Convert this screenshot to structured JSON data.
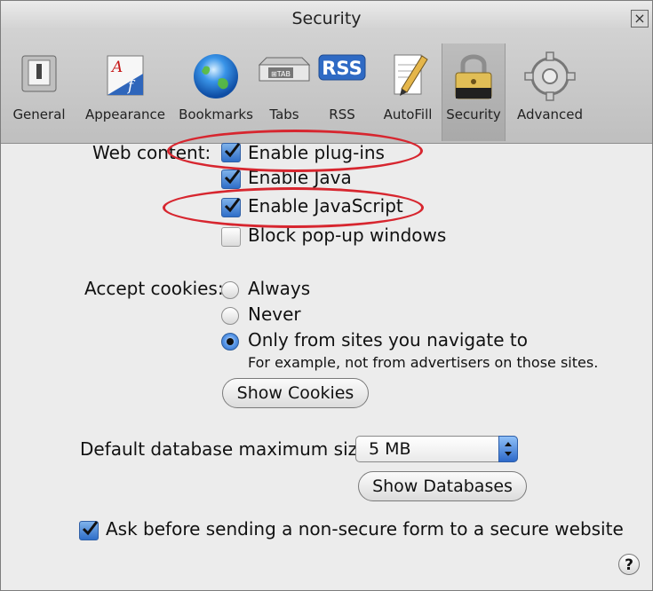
{
  "window": {
    "title": "Security",
    "close_symbol": "×"
  },
  "toolbar": {
    "items": [
      {
        "label": "General",
        "icon": "general-switch-icon"
      },
      {
        "label": "Appearance",
        "icon": "appearance-font-icon"
      },
      {
        "label": "Bookmarks",
        "icon": "globe-icon"
      },
      {
        "label": "Tabs",
        "icon": "tabs-icon"
      },
      {
        "label": "RSS",
        "icon": "rss-icon",
        "icon_text": "RSS"
      },
      {
        "label": "AutoFill",
        "icon": "autofill-pencil-icon"
      },
      {
        "label": "Security",
        "icon": "lock-icon",
        "selected": true
      },
      {
        "label": "Advanced",
        "icon": "gear-icon"
      }
    ]
  },
  "web_content": {
    "label": "Web content:",
    "options": [
      {
        "label": "Enable plug-ins",
        "checked": true
      },
      {
        "label": "Enable Java",
        "checked": true
      },
      {
        "label": "Enable JavaScript",
        "checked": true
      },
      {
        "label": "Block pop-up windows",
        "checked": false
      }
    ]
  },
  "cookies": {
    "label": "Accept cookies:",
    "options": [
      {
        "label": "Always",
        "selected": false
      },
      {
        "label": "Never",
        "selected": false
      },
      {
        "label": "Only from sites you navigate to",
        "selected": true
      }
    ],
    "note": "For example, not from advertisers on those sites.",
    "show_button": "Show Cookies"
  },
  "database": {
    "label": "Default database maximum size:",
    "value": "5 MB",
    "show_button": "Show Databases"
  },
  "secure_form": {
    "label": "Ask before sending a non-secure form to a secure website",
    "checked": true
  },
  "help_symbol": "?",
  "colors": {
    "annotation": "#d7262f",
    "checkbox_blue": "#2f6ec8"
  }
}
